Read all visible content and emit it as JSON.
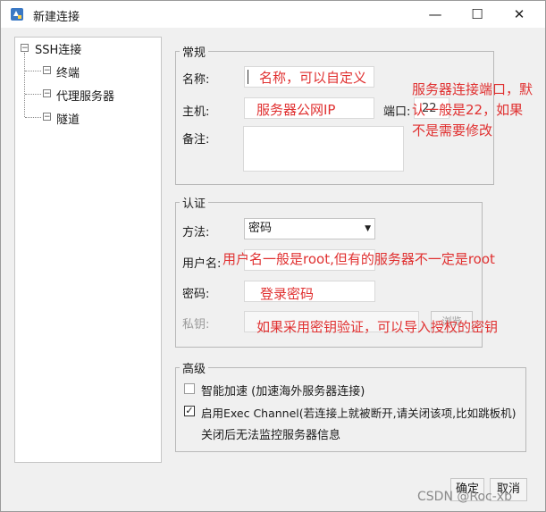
{
  "window": {
    "title": "新建连接",
    "minimize_label": "—",
    "maximize_label": "☐",
    "close_label": "✕"
  },
  "sidebar": {
    "items": [
      {
        "label": "SSH连接",
        "icon": "collapse-box-icon"
      },
      {
        "label": "终端",
        "icon": "collapse-box-icon"
      },
      {
        "label": "代理服务器",
        "icon": "collapse-box-icon"
      },
      {
        "label": "隧道",
        "icon": "collapse-box-icon"
      }
    ]
  },
  "general": {
    "title": "常规",
    "name_label": "名称:",
    "host_label": "主机:",
    "port_label": "端口:",
    "port_value": "22",
    "note_label": "备注:"
  },
  "auth": {
    "title": "认证",
    "method_label": "方法:",
    "method_value": "密码",
    "username_label": "用户名:",
    "password_label": "密码:",
    "private_key_label": "私钥:",
    "browse_label": "浏览"
  },
  "advanced": {
    "title": "高级",
    "accelerate_label": "智能加速 (加速海外服务器连接)",
    "accelerate_checked": false,
    "exec_channel_label": "启用Exec Channel(若连接上就被断开,请关闭该项,比如跳板机)",
    "exec_channel_checked": true,
    "exec_channel_note": "关闭后无法监控服务器信息"
  },
  "annotations": {
    "name": "名称，可以自定义",
    "host": "服务器公网IP",
    "port_line1": "服务器连接端口，默",
    "port_line2": "认一般是22，如果",
    "port_line3": "不是需要修改",
    "username": "用户名一般是root,但有的服务器不一定是root",
    "password": "登录密码",
    "private_key": "如果采用密钥验证，可以导入授权的密钥"
  },
  "footer": {
    "ok_label": "确定",
    "cancel_label": "取消"
  },
  "watermark": "CSDN @Roc-xb",
  "colors": {
    "annotation": "#e03030",
    "window_bg": "#f0f0f0"
  }
}
